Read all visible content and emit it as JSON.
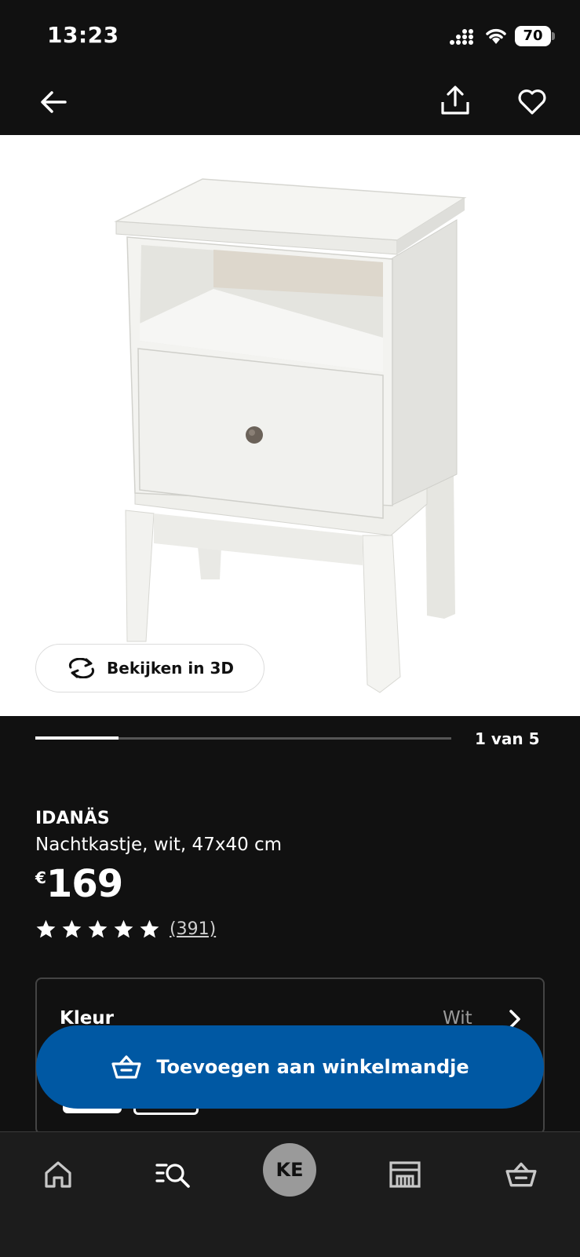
{
  "status_bar": {
    "time": "13:23",
    "battery": "70"
  },
  "product": {
    "name": "IDANÄS",
    "description": "Nachtkastje, wit, 47x40 cm",
    "price_currency": "€",
    "price": "169",
    "rating_stars": 5,
    "review_count": "(391)"
  },
  "gallery": {
    "view_3d_label": "Bekijken in 3D",
    "counter": "1 van 5",
    "progress": 0.2
  },
  "variant": {
    "label": "Kleur",
    "value": "Wit"
  },
  "cart_button": {
    "label": "Toevoegen aan winkelmandje"
  },
  "bottom_nav": {
    "avatar_initials": "KE"
  },
  "colors": {
    "accent": "#0058a3",
    "background": "#111111",
    "image_bg": "#ffffff"
  },
  "icons": [
    "back-arrow-icon",
    "share-icon",
    "heart-icon",
    "rotate-3d-icon",
    "star-icon",
    "chevron-right-icon",
    "basket-icon",
    "home-icon",
    "search-list-icon",
    "store-icon",
    "cart-icon"
  ]
}
